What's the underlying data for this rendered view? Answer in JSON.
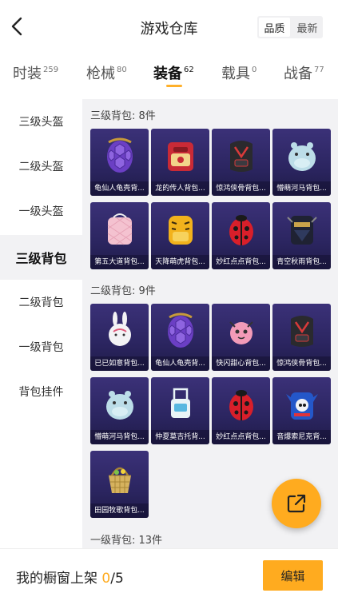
{
  "header": {
    "title": "游戏仓库",
    "sort_options": [
      "品质",
      "最新"
    ]
  },
  "tabs": [
    {
      "label": "时装",
      "count": "259"
    },
    {
      "label": "枪械",
      "count": "80"
    },
    {
      "label": "装备",
      "count": "62",
      "active": true
    },
    {
      "label": "载具",
      "count": "0"
    },
    {
      "label": "战备",
      "count": "77"
    }
  ],
  "sidebar": {
    "items": [
      "三级头盔",
      "二级头盔",
      "一级头盔",
      "三级背包",
      "二级背包",
      "一级背包",
      "背包挂件"
    ],
    "active_index": 3
  },
  "sections": [
    {
      "title": "三级背包: 8件",
      "items": [
        {
          "name": "龟仙人龟壳背...",
          "icon": "turtle-shell-backpack"
        },
        {
          "name": "龙的传人背包...",
          "icon": "red-dragon-backpack"
        },
        {
          "name": "惊鸿侠骨背包...",
          "icon": "black-red-backpack"
        },
        {
          "name": "懵萌河马背包...",
          "icon": "hippo-backpack"
        },
        {
          "name": "第五大道背包...",
          "icon": "pink-quilted-backpack"
        },
        {
          "name": "天降萌虎背包...",
          "icon": "yellow-tiger-backpack"
        },
        {
          "name": "妙红点点背包...",
          "icon": "ladybug-backpack"
        },
        {
          "name": "青空秋雨背包...",
          "icon": "dark-blue-backpack"
        }
      ]
    },
    {
      "title": "二级背包: 9件",
      "items": [
        {
          "name": "已已如意背包...",
          "icon": "white-rabbit-backpack"
        },
        {
          "name": "龟仙人龟壳背...",
          "icon": "turtle-shell-backpack"
        },
        {
          "name": "快闪甜心背包...",
          "icon": "pink-cute-backpack"
        },
        {
          "name": "惊鸿侠骨背包...",
          "icon": "black-red-backpack"
        },
        {
          "name": "懵萌河马背包...",
          "icon": "hippo-backpack"
        },
        {
          "name": "仲夏莫吉托背...",
          "icon": "mojito-backpack"
        },
        {
          "name": "妙红点点背包...",
          "icon": "ladybug-backpack"
        },
        {
          "name": "音爆索尼克背...",
          "icon": "sonic-backpack"
        },
        {
          "name": "田园牧歌背包...",
          "icon": "basket-backpack"
        }
      ]
    },
    {
      "title": "一级背包: 13件",
      "items": []
    }
  ],
  "bottom": {
    "label": "我的橱窗上架",
    "current": "0",
    "total": "/5",
    "edit_label": "编辑"
  },
  "colors": {
    "accent": "#ffab1f",
    "item_bg": "#2b2560",
    "content_bg": "#f2f2f4"
  }
}
